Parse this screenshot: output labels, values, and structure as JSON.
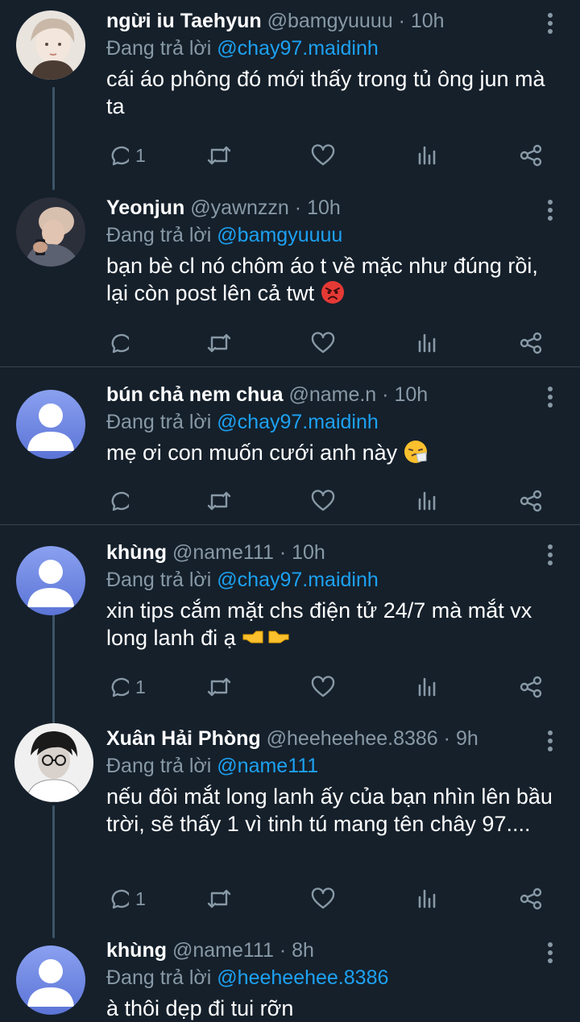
{
  "tweets": [
    {
      "name": "ngừi iu Taehyun",
      "handle": "@bamgyuuuu",
      "time": "10h",
      "reply_prefix": "Đang trả lời",
      "reply_to": "@chay97.maidinh",
      "text": "cái áo phông đó mới thấy trong tủ ông jun mà ta",
      "emoji": "",
      "reply_count": "1"
    },
    {
      "name": "Yeonjun",
      "handle": "@yawnzzn",
      "time": "10h",
      "reply_prefix": "Đang trả lời",
      "reply_to": "@bamgyuuuu",
      "text": "bạn bè cl nó chôm áo t về mặc như đúng rồi, lại còn post lên cả twt",
      "emoji": "angry-face",
      "reply_count": ""
    },
    {
      "name": "bún chả nem chua",
      "handle": "@name.n",
      "time": "10h",
      "reply_prefix": "Đang trả lời",
      "reply_to": "@chay97.maidinh",
      "text": "mẹ ơi con muốn cưới anh này",
      "emoji": "sneezing-face",
      "reply_count": ""
    },
    {
      "name": "khùng",
      "handle": "@name111",
      "time": "10h",
      "reply_prefix": "Đang trả lời",
      "reply_to": "@chay97.maidinh",
      "text": "xin tips cắm mặt chs điện tử 24/7 mà mắt vx long lanh đi ạ",
      "emoji": "pointing-hands",
      "reply_count": "1"
    },
    {
      "name": "Xuân Hải Phòng",
      "handle": "@heeheehee.8386",
      "time": "9h",
      "reply_prefix": "Đang trả lời",
      "reply_to": "@name111",
      "text": "nếu đôi mắt long lanh ấy của bạn nhìn lên bầu trời, sẽ thấy 1 vì tinh tú mang tên chây 97....",
      "emoji": "",
      "reply_count": "1"
    },
    {
      "name": "khùng",
      "handle": "@name111",
      "time": "8h",
      "reply_prefix": "Đang trả lời",
      "reply_to": "@heeheehee.8386",
      "text": "à thôi dẹp đi tui rỡn",
      "emoji": "",
      "reply_count": ""
    }
  ],
  "icons": {
    "reply": "reply-icon",
    "retweet": "retweet-icon",
    "like": "heart-icon",
    "stats": "analytics-icon",
    "share": "share-icon",
    "more": "more-options-icon"
  },
  "colors": {
    "background": "#15202b",
    "muted": "#8899a6",
    "mention": "#1da1f2",
    "divider": "#38444d"
  }
}
